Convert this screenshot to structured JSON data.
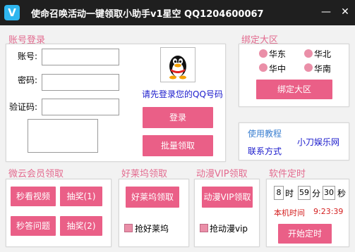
{
  "window": {
    "icon_letter": "V",
    "title": "使命召唤活动一键领取小助手v1星空 QQ1204600067",
    "minimize": "—",
    "close": "✕"
  },
  "account": {
    "title": "账号登录",
    "account_label": "账号:",
    "password_label": "密码:",
    "captcha_label": "验证码:",
    "account_value": "",
    "password_value": "",
    "captcha_value": "",
    "login_hint": "请先登录您的QQ号码",
    "login_button": "登录",
    "batch_button": "批量领取"
  },
  "region": {
    "title": "绑定大区",
    "options": [
      "华东",
      "华北",
      "华中",
      "华南"
    ],
    "bind_button": "绑定大区"
  },
  "links": {
    "tutorial": "使用教程",
    "studio": "小刀娱乐网",
    "contact": "联系方式"
  },
  "weiyun": {
    "title": "微云会员领取",
    "buttons": [
      "秒看视频",
      "抽奖(1)",
      "秒答问题",
      "抽奖(2)"
    ]
  },
  "hollywood": {
    "title": "好莱坞领取",
    "button": "好莱坞领取",
    "checkbox": "抢好莱坞"
  },
  "anime": {
    "title": "动漫VIP领取",
    "button": "动漫VIP领取",
    "checkbox": "抢动漫vip"
  },
  "timer": {
    "title": "软件定时",
    "hour": "8",
    "hour_unit": "时",
    "minute": "59",
    "minute_unit": "分",
    "second": "30",
    "second_unit": "秒",
    "local_time_label": "本机时间",
    "local_time": "9:23:39",
    "start_button": "开始定时"
  },
  "colors": {
    "accent": "#ea5f87",
    "title_pink": "#e36b8f",
    "link_blue": "#1a1acc",
    "time_red": "#d42020"
  }
}
